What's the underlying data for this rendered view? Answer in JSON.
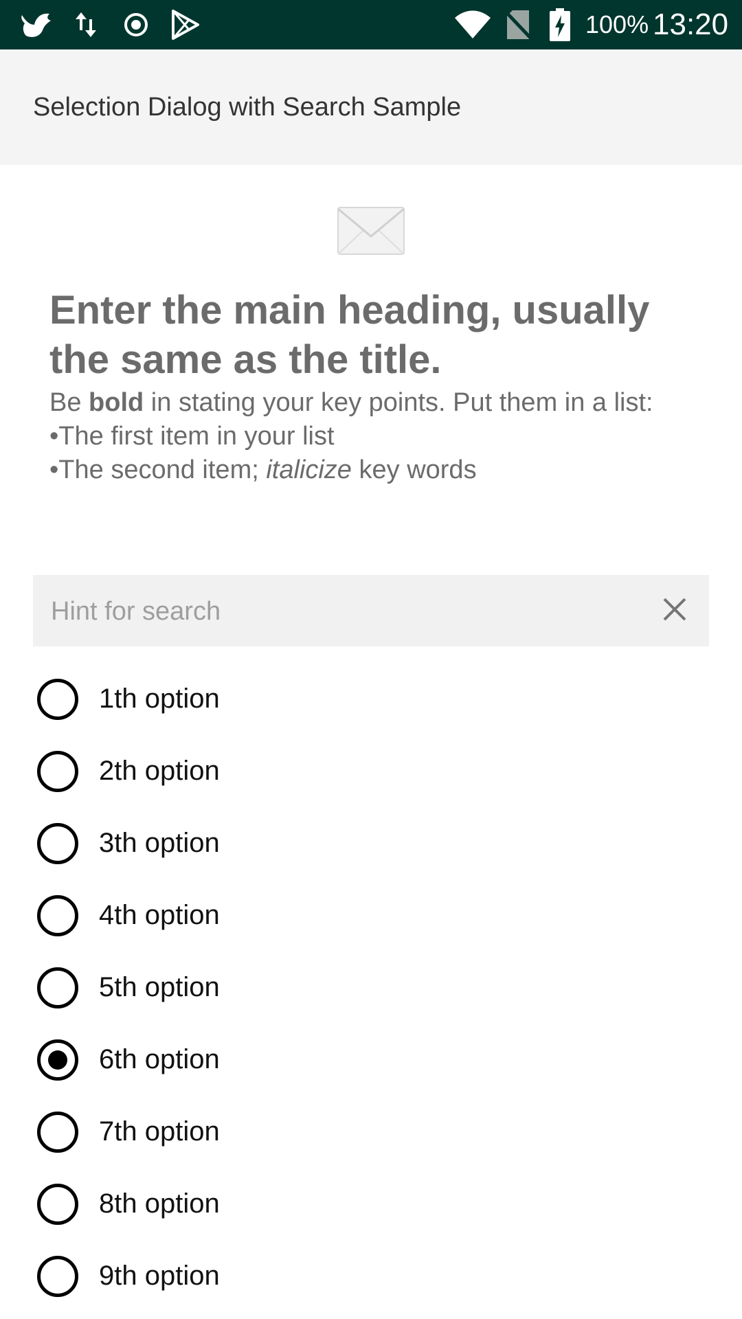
{
  "status_bar": {
    "battery_percent": "100%",
    "time": "13:20",
    "left_icons": [
      "bird-app-icon",
      "data-transfer-icon",
      "sync-icon",
      "play-store-icon"
    ],
    "right_icons": [
      "wifi-icon",
      "no-sim-icon",
      "battery-charging-icon"
    ]
  },
  "app_bar": {
    "title": "Selection Dialog with Search Sample"
  },
  "content": {
    "icon": "envelope-icon",
    "heading": "Enter the main heading, usually the same as the title.",
    "body_prefix": "Be ",
    "body_bold": "bold",
    "body_suffix": " in stating your key points. Put them in a list:",
    "list_item_1": "•The first item in your list",
    "list_item_2_prefix": "•The second item; ",
    "list_item_2_italic": "italicize",
    "list_item_2_suffix": " key words"
  },
  "search": {
    "placeholder": "Hint for search",
    "value": "",
    "clear_icon": "close-icon"
  },
  "options": [
    {
      "label": "1th option",
      "checked": false
    },
    {
      "label": "2th option",
      "checked": false
    },
    {
      "label": "3th option",
      "checked": false
    },
    {
      "label": "4th option",
      "checked": false
    },
    {
      "label": "5th option",
      "checked": false
    },
    {
      "label": "6th option",
      "checked": true
    },
    {
      "label": "7th option",
      "checked": false
    },
    {
      "label": "8th option",
      "checked": false
    },
    {
      "label": "9th option",
      "checked": false
    }
  ],
  "colors": {
    "status_bar": "#00362e",
    "app_bar": "#f4f4f4",
    "search_bg": "#f1f1f1",
    "heading_text": "#6b6b6b"
  }
}
